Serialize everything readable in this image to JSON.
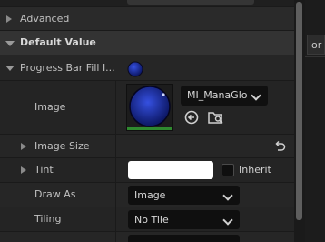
{
  "sections": {
    "advanced": "Advanced",
    "default_value": "Default Value"
  },
  "property": {
    "name": "Progress Bar Fill I..."
  },
  "image": {
    "label": "Image",
    "asset_name": "MI_ManaGlo"
  },
  "image_size": {
    "label": "Image Size"
  },
  "tint": {
    "label": "Tint",
    "color": "#ffffff",
    "inherit_label": "Inherit"
  },
  "draw_as": {
    "label": "Draw As",
    "value": "Image"
  },
  "tiling": {
    "label": "Tiling",
    "value": "No Tile"
  },
  "right_panel": {
    "partial_text": "lor"
  },
  "icons": {
    "use_selected": "arrow-left-circle-icon",
    "browse": "folder-search-icon",
    "reset": "reset-arrow-icon",
    "expand": "triangle-right-icon",
    "collapse": "triangle-down-icon"
  },
  "colors": {
    "orb_dark": "#0b1560",
    "orb_light": "#3550e0",
    "thumb_bar": "#2f8a2f"
  }
}
